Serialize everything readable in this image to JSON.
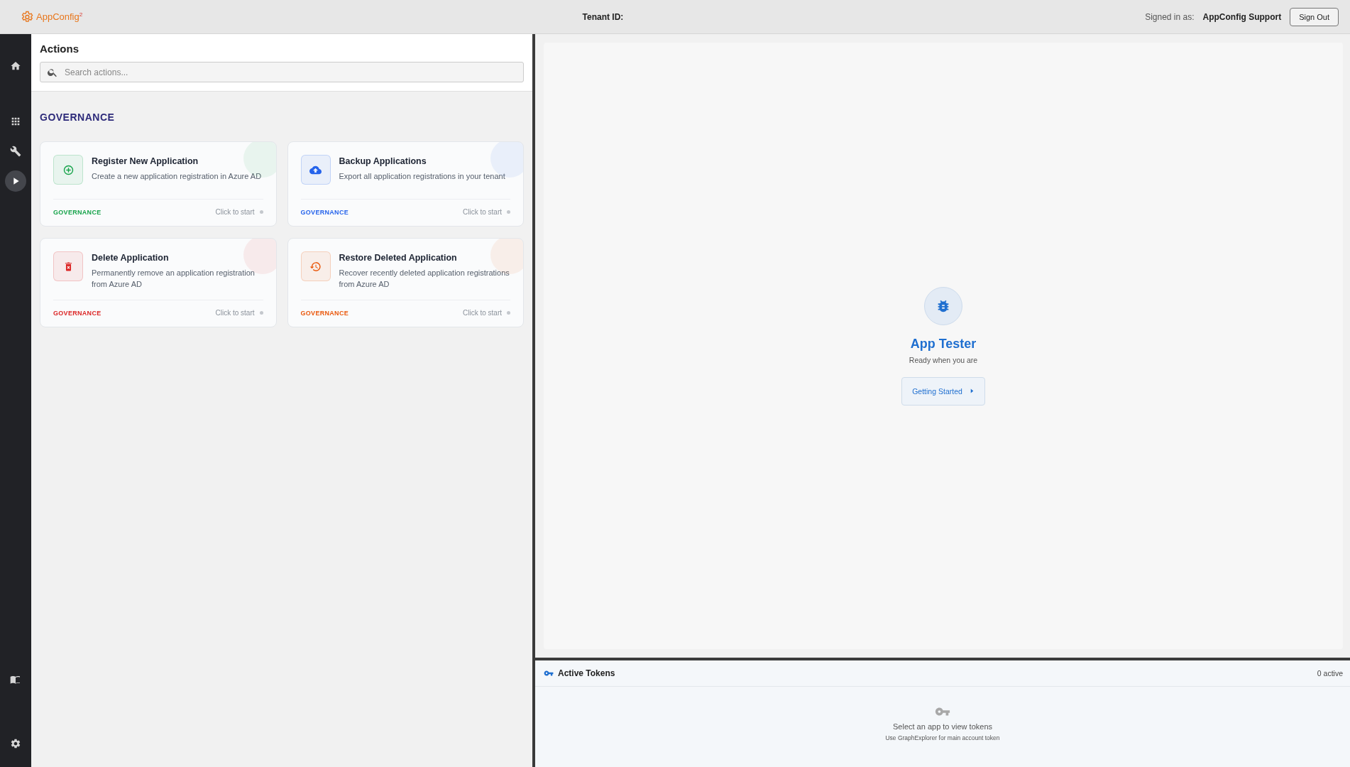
{
  "header": {
    "logo": "AppConfig$^{2}$",
    "tenant_label": "Tenant ID:",
    "signed_in_label": "Signed in as:",
    "user": "AppConfig Support",
    "sign_out": "Sign Out"
  },
  "sidebar": {
    "items": [
      {
        "kind": "home",
        "selected": false
      },
      {
        "kind": "apps",
        "selected": false
      },
      {
        "kind": "tools",
        "selected": false
      },
      {
        "kind": "play",
        "selected": true
      }
    ],
    "bottom_items": [
      {
        "kind": "book",
        "selected": false
      },
      {
        "kind": "settings",
        "selected": false
      }
    ]
  },
  "actions": {
    "title": "Actions",
    "search": {
      "placeholder": "Search actions..."
    },
    "section": "GOVERNANCE",
    "cards": [
      {
        "kind": "add",
        "title": "Register New Application",
        "description": "Create a new application registration in Azure AD",
        "tag": "GOVERNANCE",
        "color": "#16a34a",
        "hint": "Click to start"
      },
      {
        "kind": "upload",
        "title": "Backup Applications",
        "description": "Export all application registrations in your tenant",
        "tag": "GOVERNANCE",
        "color": "#2563eb",
        "hint": "Click to start"
      },
      {
        "kind": "delete",
        "title": "Delete Application",
        "description": "Permanently remove an application registration from Azure AD",
        "tag": "GOVERNANCE",
        "color": "#dc2626",
        "hint": "Click to start"
      },
      {
        "kind": "restore",
        "title": "Restore Deleted Application",
        "description": "Recover recently deleted application registrations from Azure AD",
        "tag": "GOVERNANCE",
        "color": "#ea580c",
        "hint": "Click to start"
      }
    ]
  },
  "tester": {
    "title": "App Tester",
    "subtitle": "Ready when you are",
    "button": "Getting Started"
  },
  "tokens": {
    "title": "Active Tokens",
    "count": "0 active",
    "empty_title": "Select an app to view tokens",
    "empty_hint": "Use GraphExplorer for main account token"
  }
}
